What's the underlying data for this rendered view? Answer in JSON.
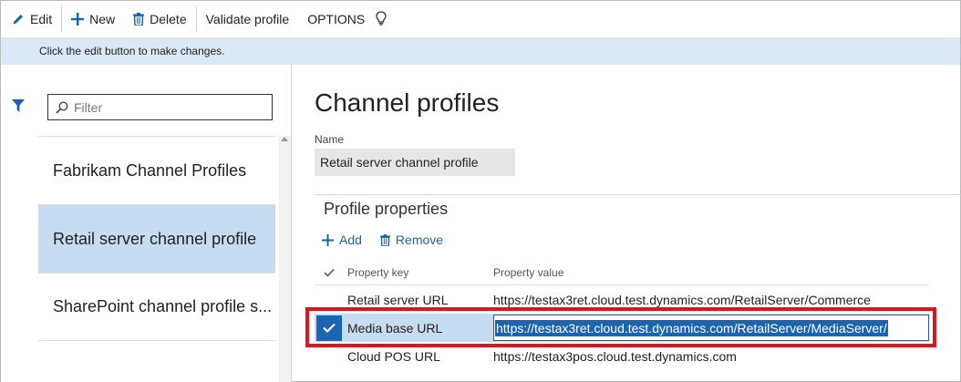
{
  "toolbar": {
    "edit_label": "Edit",
    "new_label": "New",
    "delete_label": "Delete",
    "validate_label": "Validate profile",
    "options_label": "OPTIONS",
    "icons": {
      "edit": "pencil-icon",
      "new": "plus-icon",
      "delete": "trash-icon",
      "tip": "lightbulb-icon"
    }
  },
  "infobar": {
    "message": "Click the edit button to make changes."
  },
  "sidebar": {
    "filter_placeholder": "Filter",
    "items": [
      {
        "label": "Fabrikam Channel Profiles",
        "selected": false
      },
      {
        "label": "Retail server channel profile",
        "selected": true
      },
      {
        "label": "SharePoint channel profile s...",
        "selected": false
      }
    ]
  },
  "main": {
    "title": "Channel profiles",
    "name_label": "Name",
    "name_value": "Retail server channel profile",
    "section_title": "Profile properties",
    "add_label": "Add",
    "remove_label": "Remove",
    "columns": {
      "key": "Property key",
      "value": "Property value"
    },
    "rows": [
      {
        "key": "Retail server URL",
        "value": "https://testax3ret.cloud.test.dynamics.com/RetailServer/Commerce",
        "selected": false
      },
      {
        "key": "Media base URL",
        "value": "https://testax3ret.cloud.test.dynamics.com/RetailServer/MediaServer/",
        "selected": true
      },
      {
        "key": "Cloud POS URL",
        "value": "https://testax3pos.cloud.test.dynamics.com",
        "selected": false
      }
    ]
  },
  "colors": {
    "accent": "#1a64b4",
    "selection": "#c6dcf1",
    "infobar": "#dbe8f6",
    "highlight_border": "#e0141e"
  }
}
